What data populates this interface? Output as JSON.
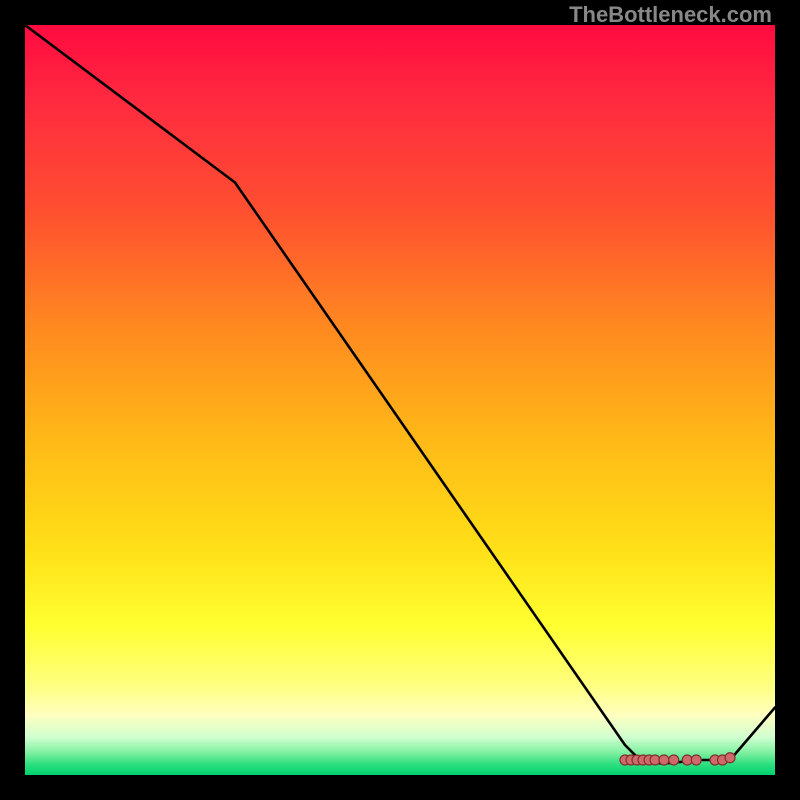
{
  "watermark": "TheBottleneck.com",
  "chart_data": {
    "type": "line",
    "title": "",
    "xlabel": "",
    "ylabel": "",
    "x_range": [
      0,
      100
    ],
    "y_range": [
      0,
      100
    ],
    "line": {
      "points": [
        {
          "x": 0,
          "y": 100
        },
        {
          "x": 28,
          "y": 79
        },
        {
          "x": 80,
          "y": 4
        },
        {
          "x": 82,
          "y": 2
        },
        {
          "x": 85,
          "y": 1.5
        },
        {
          "x": 90,
          "y": 2
        },
        {
          "x": 94,
          "y": 2
        },
        {
          "x": 100,
          "y": 9
        }
      ],
      "color": "#000000"
    },
    "markers": {
      "color_fill": "#d06a6a",
      "color_stroke": "#803030",
      "cluster_approx_region": {
        "x_start": 80,
        "x_end": 94,
        "y": 2
      },
      "points": [
        {
          "x": 80.0,
          "y": 2.0
        },
        {
          "x": 80.8,
          "y": 2.0
        },
        {
          "x": 81.6,
          "y": 2.0
        },
        {
          "x": 82.4,
          "y": 2.0
        },
        {
          "x": 83.2,
          "y": 2.0
        },
        {
          "x": 84.0,
          "y": 2.0
        },
        {
          "x": 85.2,
          "y": 2.0
        },
        {
          "x": 86.5,
          "y": 2.0
        },
        {
          "x": 88.3,
          "y": 2.0
        },
        {
          "x": 89.5,
          "y": 2.0
        },
        {
          "x": 92.0,
          "y": 2.0
        },
        {
          "x": 93.0,
          "y": 2.0
        },
        {
          "x": 94.0,
          "y": 2.3
        }
      ]
    },
    "background_gradient": {
      "orientation": "vertical",
      "stops": [
        {
          "pos": 0.0,
          "color": "#ff0a40"
        },
        {
          "pos": 0.25,
          "color": "#ff5030"
        },
        {
          "pos": 0.55,
          "color": "#ffb818"
        },
        {
          "pos": 0.8,
          "color": "#ffff30"
        },
        {
          "pos": 0.95,
          "color": "#d0ffd0"
        },
        {
          "pos": 1.0,
          "color": "#00d070"
        }
      ]
    }
  }
}
